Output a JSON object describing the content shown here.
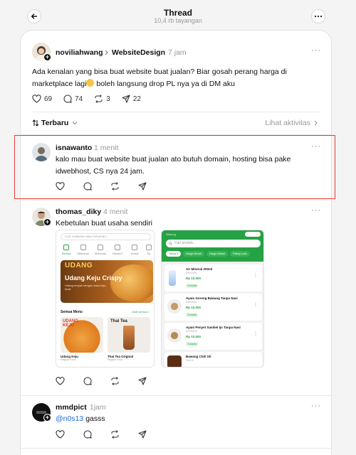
{
  "header": {
    "title": "Thread",
    "views": "10,4 rb tayangan"
  },
  "op": {
    "username": "noviliahwang",
    "community": "WebsiteDesign",
    "time": "7 jam",
    "text_before_emoji": "Ada kenalan yang bisa buat website buat jualan? Biar gosah perang harga di marketplace lagi",
    "text_after_emoji": " boleh langsung drop PL nya ya di DM aku",
    "likes": "69",
    "comments": "74",
    "reposts": "3",
    "shares": "22",
    "avatar_plus": "+"
  },
  "sort": {
    "label": "Terbaru",
    "activity": "Lihat aktivitas"
  },
  "replies": [
    {
      "username": "isnawanto",
      "time": "1 menit",
      "text": "kalo mau buat website buat jualan ato butuh domain, hosting bisa pake idwebhost, CS nya 24 jam."
    },
    {
      "username": "thomas_diky",
      "time": "4 menit",
      "text": "Kebetulan buat usaha sendiri"
    },
    {
      "username": "mmdpict",
      "time": "1jam",
      "mention": "@n0s13",
      "text": " gasss"
    }
  ],
  "shot1": {
    "search": "Cari makanan atau minuman...",
    "categories": [
      "Semua",
      "Makanan",
      "Minuman",
      "Dessert",
      "Snack",
      "Sp"
    ],
    "banner_brand": "UDANG",
    "banner_title": "Udang Keju Crispy",
    "banner_sub": "Udang renyah dengan saus keju lezat",
    "section": "Semua Menu",
    "see_all": "Lihat semua >",
    "items": [
      {
        "name": "Udang Keju",
        "sub": "Regular Food",
        "img_text": "UDANG KEJU"
      },
      {
        "name": "Thai Tea Original",
        "sub": "Regular Food",
        "img_text": "Thai Tea"
      }
    ]
  },
  "shot2": {
    "title": "Warung",
    "search": "Cari produk...",
    "chips": [
      "Terbaru",
      "Harga Murah",
      "Harga Mahal",
      "Paling Laris"
    ],
    "products": [
      {
        "name": "Air Mineral 200ml",
        "cat": "MINUMAN",
        "price": "Rp 10.000",
        "status": "Tersedia"
      },
      {
        "name": "Ayam Goreng Bawang Tanpa Nasi",
        "cat": "MAKANAN",
        "price": "Rp 10.000",
        "status": "Tersedia"
      },
      {
        "name": "Ayam Penyet Sambel Ijo Tanpa Nasi",
        "cat": "MAKANAN",
        "price": "Rp 10.000",
        "status": "Tersedia"
      },
      {
        "name": "Bawang Chili Oil",
        "cat": "SNACK"
      }
    ]
  },
  "colors": {
    "accent": "#1d6ae5",
    "green": "#25a244",
    "highlight": "#e53935"
  }
}
